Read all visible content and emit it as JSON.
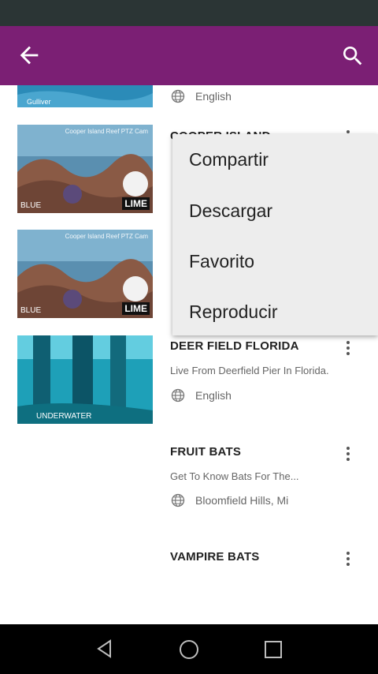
{
  "app_bar": {
    "back_icon": "arrow-back-icon",
    "search_icon": "search-icon",
    "color": "#7b1f74"
  },
  "list": {
    "items": [
      {
        "title": "",
        "description": "",
        "meta": "English",
        "thumb_text": "Gulliver",
        "thumb_style": "ocean"
      },
      {
        "title": "COOPER ISLAND",
        "description": "",
        "meta": "",
        "thumb_text": "Cooper Island Reef PTZ Cam",
        "badge": "LIME",
        "logo": "BLUE",
        "thumb_style": "reef"
      },
      {
        "title": "",
        "description": "",
        "meta": "",
        "thumb_text": "Cooper Island Reef PTZ Cam",
        "badge": "LIME",
        "logo": "BLUE",
        "thumb_style": "reef"
      },
      {
        "title": "DEER FIELD FLORIDA",
        "description": "Live From Deerfield Pier In Florida.",
        "meta": "English",
        "logo": "UNDERWATER",
        "thumb_style": "pier"
      },
      {
        "title": "FRUIT BATS",
        "description": "Get To Know Bats For The...",
        "meta": "Bloomfield Hills, Mi"
      },
      {
        "title": "VAMPIRE BATS",
        "description": "",
        "meta": ""
      }
    ]
  },
  "context_menu": {
    "items": [
      "Compartir",
      "Descargar",
      "Favorito",
      "Reproducir"
    ]
  },
  "nav_bar": {
    "back_icon": "nav-back-icon",
    "home_icon": "nav-home-icon",
    "recents_icon": "nav-recents-icon"
  }
}
